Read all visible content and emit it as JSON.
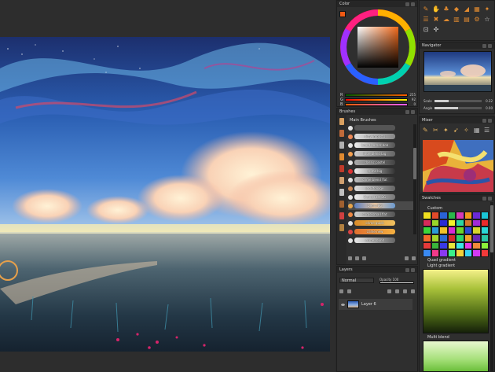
{
  "panels": {
    "color": {
      "title": "Color",
      "rgb": [
        {
          "label": "R",
          "value": "255"
        },
        {
          "label": "G",
          "value": "92"
        },
        {
          "label": "B",
          "value": "0"
        }
      ]
    },
    "brushes": {
      "title": "Brushes",
      "group": "Main Brushes",
      "items": [
        {
          "name": ""
        },
        {
          "name": "dirty impasto"
        },
        {
          "name": "board corner bob"
        },
        {
          "name": "little blend big"
        },
        {
          "name": "classic pastel"
        },
        {
          "name": "crime big"
        },
        {
          "name": "crime blend flat"
        },
        {
          "name": "jack foliage"
        },
        {
          "name": "Demo Fast BG"
        },
        {
          "name": "Demo BG"
        },
        {
          "name": "crime small flat"
        },
        {
          "name": "crime quick"
        },
        {
          "name": "crime new"
        },
        {
          "name": "crime round"
        }
      ]
    },
    "layers": {
      "title": "Layers",
      "blend_mode": "Normal",
      "opacity_label": "Opacity",
      "opacity_value": "100",
      "layer_name": "Layer 6"
    },
    "navigator": {
      "title": "Navigator",
      "scale_label": "Scale",
      "scale_value": "0.32",
      "scale_fraction": 0.3,
      "angle_label": "Angle",
      "angle_value": "0.00",
      "angle_fraction": 0.5
    },
    "mixer": {
      "title": "Mixer"
    },
    "swatches": {
      "title": "Swatches",
      "group_custom": "Custom",
      "group_quad": "Quad gradient",
      "group_light": "Light gradient",
      "group_multi": "Multi blend"
    }
  },
  "colors": {
    "foreground": "#f05a14",
    "accent": "#e08a30",
    "panel_bg": "#2f2f2f"
  },
  "icons": [
    "brush-icon",
    "hand-icon",
    "stamp-icon",
    "fill-icon",
    "eraser-icon",
    "gradient-icon",
    "eyedropper-icon",
    "smudge-icon",
    "text-icon",
    "layers-icon",
    "grid-icon",
    "pattern-icon",
    "star-icon",
    "settings-icon"
  ]
}
